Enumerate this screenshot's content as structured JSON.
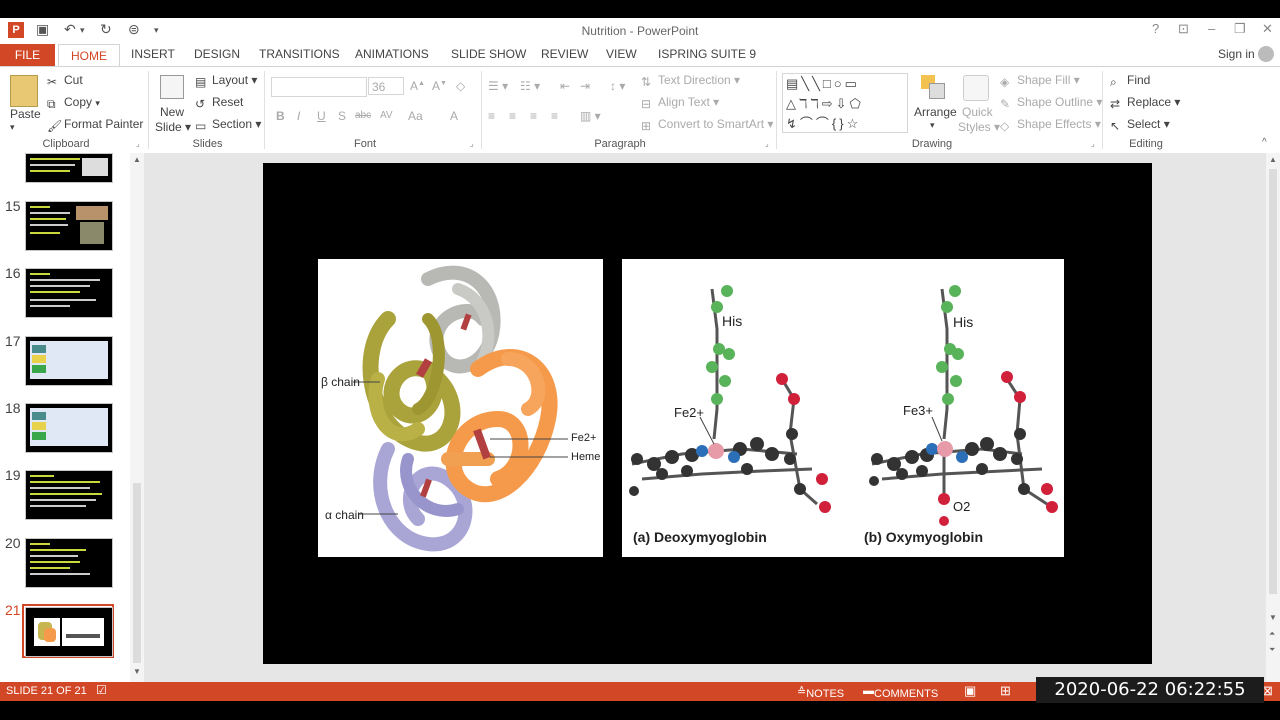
{
  "window": {
    "title": "Nutrition - PowerPoint",
    "sign_in": "Sign in"
  },
  "tabs": [
    "FILE",
    "HOME",
    "INSERT",
    "DESIGN",
    "TRANSITIONS",
    "ANIMATIONS",
    "SLIDE SHOW",
    "REVIEW",
    "VIEW",
    "ISPRING SUITE 9"
  ],
  "ribbon": {
    "clipboard": {
      "paste": "Paste",
      "cut": "Cut",
      "copy": "Copy",
      "format_painter": "Format Painter",
      "label": "Clipboard"
    },
    "slides": {
      "new_slide_1": "New",
      "new_slide_2": "Slide",
      "layout": "Layout",
      "reset": "Reset",
      "section": "Section",
      "label": "Slides"
    },
    "font": {
      "size": "36",
      "label": "Font",
      "bold": "B",
      "italic": "I",
      "underline": "U",
      "shadow": "S",
      "strike": "abc",
      "char_spacing": "AV",
      "case": "Aa",
      "color": "A"
    },
    "paragraph": {
      "text_direction": "Text Direction",
      "align_text": "Align Text",
      "convert_smartart": "Convert to SmartArt",
      "label": "Paragraph"
    },
    "drawing": {
      "arrange": "Arrange",
      "quick_styles_1": "Quick",
      "quick_styles_2": "Styles",
      "shape_fill": "Shape Fill",
      "shape_outline": "Shape Outline",
      "shape_effects": "Shape Effects",
      "label": "Drawing"
    },
    "editing": {
      "find": "Find",
      "replace": "Replace",
      "select": "Select",
      "label": "Editing"
    }
  },
  "slides": [
    {
      "num": "15"
    },
    {
      "num": "16"
    },
    {
      "num": "17"
    },
    {
      "num": "18"
    },
    {
      "num": "19"
    },
    {
      "num": "20"
    },
    {
      "num": "21"
    }
  ],
  "figure": {
    "beta_chain": "β chain",
    "alpha_chain": "α chain",
    "fe2_label": "Fe2+",
    "heme": "Heme",
    "his": "His",
    "fe2_small": "Fe2+",
    "fe3_small": "Fe3+",
    "o2": "O2",
    "deoxy": "(a) Deoxymyoglobin",
    "oxy": "(b) Oxymyoglobin"
  },
  "status": {
    "slide_counter": "SLIDE 21 OF 21",
    "notes": "NOTES",
    "comments": "COMMENTS"
  },
  "timestamp": "2020-06-22 06:22:55",
  "colors": {
    "accent": "#d24726"
  }
}
